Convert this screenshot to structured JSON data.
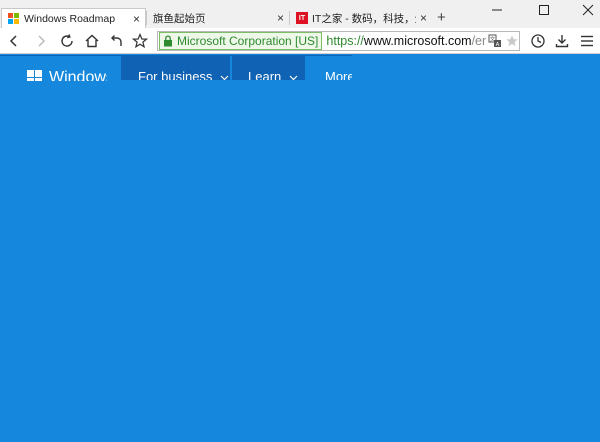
{
  "browser": {
    "tabs": [
      {
        "title": "Windows Roadmap",
        "active": true,
        "icon": "microsoft-logo-icon"
      },
      {
        "title": "旗鱼起始页",
        "active": false,
        "icon": ""
      },
      {
        "title": "IT之家 - 数码，科技，生活",
        "active": false,
        "icon": "ithome-icon",
        "icon_text": "IT"
      }
    ],
    "new_tab_label": "+",
    "close_glyph": "×",
    "address_bar": {
      "ev_label": "Microsoft Corporation [US]",
      "url_scheme": "https://",
      "url_host": "www.microsoft.com",
      "url_path": "/en"
    },
    "colors": {
      "ev_green": "#2e8a2e",
      "ms_red": "#f25022",
      "ms_green": "#7fba00",
      "ms_blue": "#00a4ef",
      "ms_yellow": "#ffb900"
    }
  },
  "site": {
    "logo_text": "Windows",
    "nav": [
      {
        "label": "For business",
        "has_dropdown": true
      },
      {
        "label": "Learn",
        "has_dropdown": true
      },
      {
        "label": "More",
        "has_dropdown": false
      }
    ],
    "colors": {
      "background": "#1588dd",
      "nav_active": "#0f62b4"
    }
  }
}
